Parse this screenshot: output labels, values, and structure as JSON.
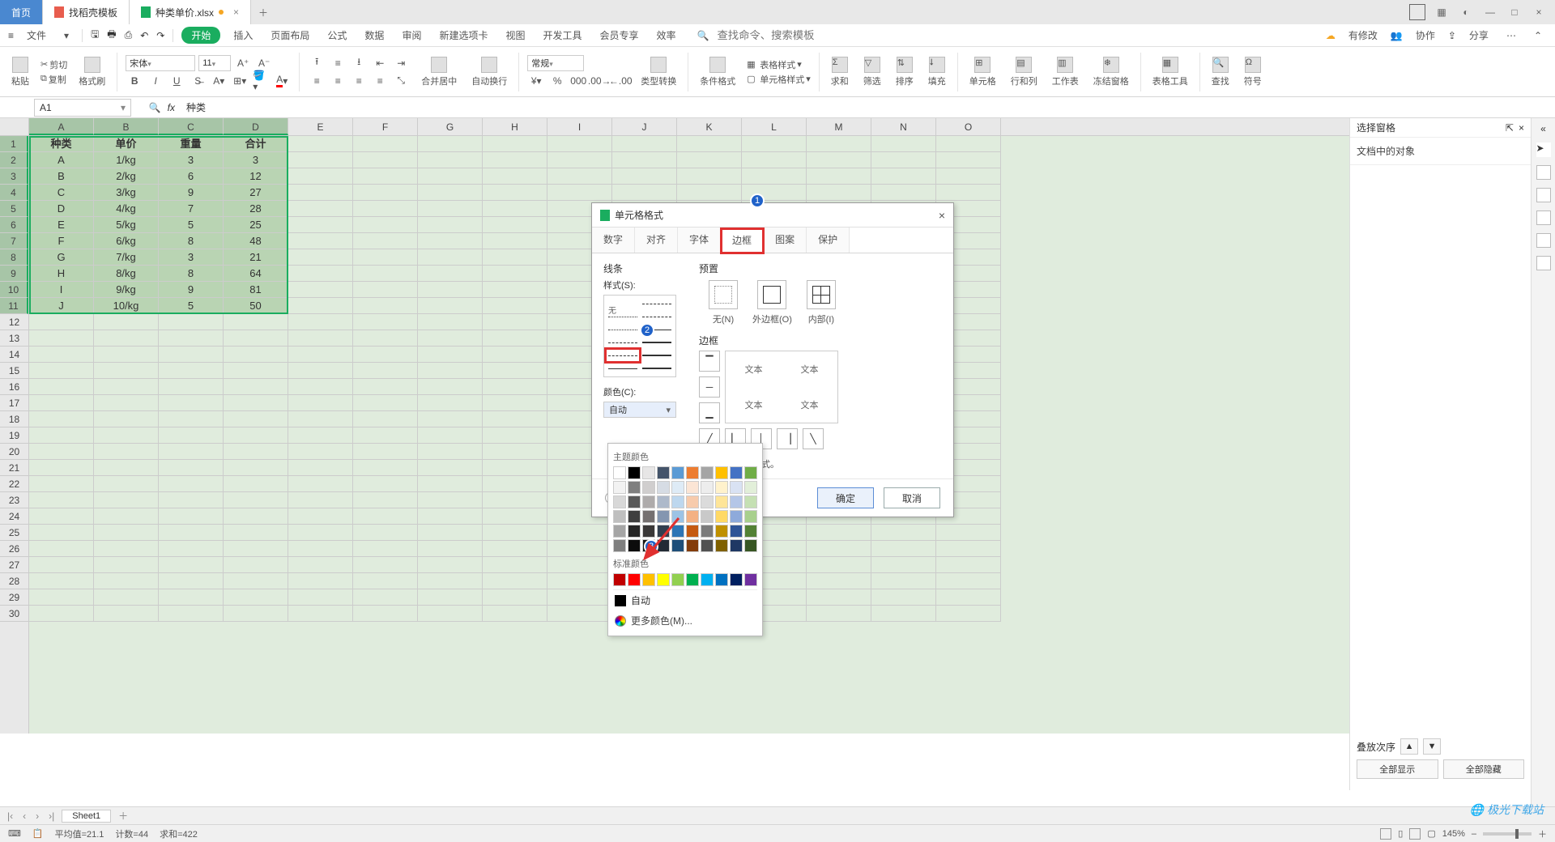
{
  "titlebar": {
    "home": "首页",
    "t2": "找稻壳模板",
    "t3": "种类单价.xlsx"
  },
  "menu": {
    "file": "文件",
    "start": "开始",
    "insert": "插入",
    "layout": "页面布局",
    "formula": "公式",
    "data": "数据",
    "review": "审阅",
    "newtab": "新建选项卡",
    "view": "视图",
    "dev": "开发工具",
    "member": "会员专享",
    "efficiency": "效率",
    "search_placeholder": "查找命令、搜索模板",
    "has_changes": "有修改",
    "collab": "协作",
    "share": "分享"
  },
  "ribbon": {
    "paste": "粘贴",
    "cut": "剪切",
    "copy": "复制",
    "fmtpainter": "格式刷",
    "font": "宋体",
    "size": "11",
    "merge": "合并居中",
    "wrap": "自动换行",
    "general": "常规",
    "typeconv": "类型转换",
    "condfmt": "条件格式",
    "tblstyle": "表格样式",
    "cellstyle": "单元格样式",
    "sum": "求和",
    "filter": "筛选",
    "sort": "排序",
    "fill": "填充",
    "cells": "单元格",
    "rowcol": "行和列",
    "sheet": "工作表",
    "freeze": "冻结窗格",
    "tbltools": "表格工具",
    "find": "查找",
    "symbol": "符号"
  },
  "namebox": "A1",
  "formula": "种类",
  "columns": [
    "A",
    "B",
    "C",
    "D",
    "E",
    "F",
    "G",
    "H",
    "I",
    "J",
    "K",
    "L",
    "M",
    "N",
    "O"
  ],
  "headers": [
    "种类",
    "单价",
    "重量",
    "合计"
  ],
  "rows": [
    [
      "A",
      "1/kg",
      "3",
      "3"
    ],
    [
      "B",
      "2/kg",
      "6",
      "12"
    ],
    [
      "C",
      "3/kg",
      "9",
      "27"
    ],
    [
      "D",
      "4/kg",
      "7",
      "28"
    ],
    [
      "E",
      "5/kg",
      "5",
      "25"
    ],
    [
      "F",
      "6/kg",
      "8",
      "48"
    ],
    [
      "G",
      "7/kg",
      "3",
      "21"
    ],
    [
      "H",
      "8/kg",
      "8",
      "64"
    ],
    [
      "I",
      "9/kg",
      "9",
      "81"
    ],
    [
      "J",
      "10/kg",
      "5",
      "50"
    ]
  ],
  "taskpane": {
    "title": "选择窗格",
    "section": "文档中的对象",
    "order": "叠放次序",
    "show_all": "全部显示",
    "hide_all": "全部隐藏"
  },
  "sheettab": "Sheet1",
  "status": {
    "avg": "平均值=21.1",
    "count": "计数=44",
    "sum": "求和=422",
    "zoom": "145%"
  },
  "dialog": {
    "title": "单元格格式",
    "tabs": [
      "数字",
      "对齐",
      "字体",
      "边框",
      "图案",
      "保护"
    ],
    "line": "线条",
    "style": "样式(S):",
    "none": "无",
    "color": "颜色(C):",
    "color_auto": "自动",
    "preset": "预置",
    "preset_none": "无(N)",
    "preset_outer": "外边框(O)",
    "preset_inner": "内部(I)",
    "border": "边框",
    "sample": "文本",
    "hint": "可以添加边框样式。",
    "ok": "确定",
    "cancel": "取消"
  },
  "colordrop": {
    "theme": "主题颜色",
    "standard": "标准颜色",
    "auto": "自动",
    "more": "更多颜色(M)..."
  },
  "theme_colors": [
    "#ffffff",
    "#000000",
    "#e7e6e6",
    "#44546a",
    "#5b9bd5",
    "#ed7d31",
    "#a5a5a5",
    "#ffc000",
    "#4472c4",
    "#70ad47",
    "#f2f2f2",
    "#7f7f7f",
    "#d0cece",
    "#d6dce4",
    "#deebf6",
    "#fbe5d5",
    "#ededed",
    "#fff2cc",
    "#d9e2f3",
    "#e2efd9",
    "#d8d8d8",
    "#595959",
    "#aeabab",
    "#adb9ca",
    "#bdd7ee",
    "#f7cbac",
    "#dbdbdb",
    "#fee599",
    "#b4c6e7",
    "#c5e0b3",
    "#bfbfbf",
    "#3f3f3f",
    "#757070",
    "#8496b0",
    "#9cc3e5",
    "#f4b183",
    "#c9c9c9",
    "#ffd965",
    "#8eaadb",
    "#a8d08d",
    "#a5a5a5",
    "#262626",
    "#3a3838",
    "#323f4f",
    "#2e75b5",
    "#c55a11",
    "#7b7b7b",
    "#bf9000",
    "#2f5496",
    "#538135",
    "#7f7f7f",
    "#0c0c0c",
    "#171616",
    "#222a35",
    "#1e4e79",
    "#833c0b",
    "#525252",
    "#7f6000",
    "#1f3864",
    "#375623"
  ],
  "standard_colors": [
    "#c00000",
    "#ff0000",
    "#ffc000",
    "#ffff00",
    "#92d050",
    "#00b050",
    "#00b0f0",
    "#0070c0",
    "#002060",
    "#7030a0"
  ],
  "watermark_a": "极光",
  "watermark_b": "下载站"
}
